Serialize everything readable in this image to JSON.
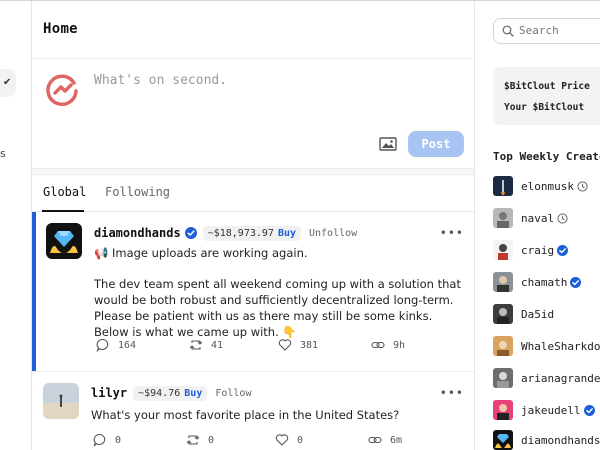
{
  "header": {
    "title": "Home"
  },
  "compose": {
    "placeholder": "What's on second.",
    "post_label": "Post"
  },
  "tabs": [
    {
      "label": "Global",
      "active": true
    },
    {
      "label": "Following",
      "active": false
    }
  ],
  "posts": [
    {
      "username": "diamondhands",
      "verified": true,
      "price": "~$18,973.97",
      "buy_label": "Buy",
      "follow_label": "Unfollow",
      "line1": "📢 Image uploads are working again.",
      "line2": "The dev team spent all weekend coming up with a solution that would be both robust and sufficiently decentralized long-term. Please be patient with us as there may still be some kinks. Below is what we came up with. 👇",
      "comments": "164",
      "reclouts": "41",
      "likes": "381",
      "time": "9h"
    },
    {
      "username": "lilyr",
      "verified": false,
      "price": "~$94.76",
      "buy_label": "Buy",
      "follow_label": "Follow",
      "line1": "What's your most favorite place in the United States?",
      "comments": "0",
      "reclouts": "0",
      "likes": "0",
      "time": "6m"
    }
  ],
  "sidebar": {
    "search_placeholder": "Search",
    "bitclout_price_label": "$BitClout Price",
    "your_bitclout_label": "Your $BitClout",
    "top_creators_title": "Top Weekly Creators",
    "creators": [
      {
        "name": "elonmusk",
        "badge": "clock"
      },
      {
        "name": "naval",
        "badge": "clock"
      },
      {
        "name": "craig",
        "badge": "verified"
      },
      {
        "name": "chamath",
        "badge": "verified"
      },
      {
        "name": "Da5id",
        "badge": "none"
      },
      {
        "name": "WhaleSharkdo",
        "badge": "none"
      },
      {
        "name": "arianagrande",
        "badge": "none"
      },
      {
        "name": "jakeudell",
        "badge": "verified"
      },
      {
        "name": "diamondhands",
        "badge": "none"
      }
    ]
  },
  "colors": {
    "accent": "#1e5fd9",
    "post_button": "#a7c4f3",
    "logo": "#e06666"
  }
}
